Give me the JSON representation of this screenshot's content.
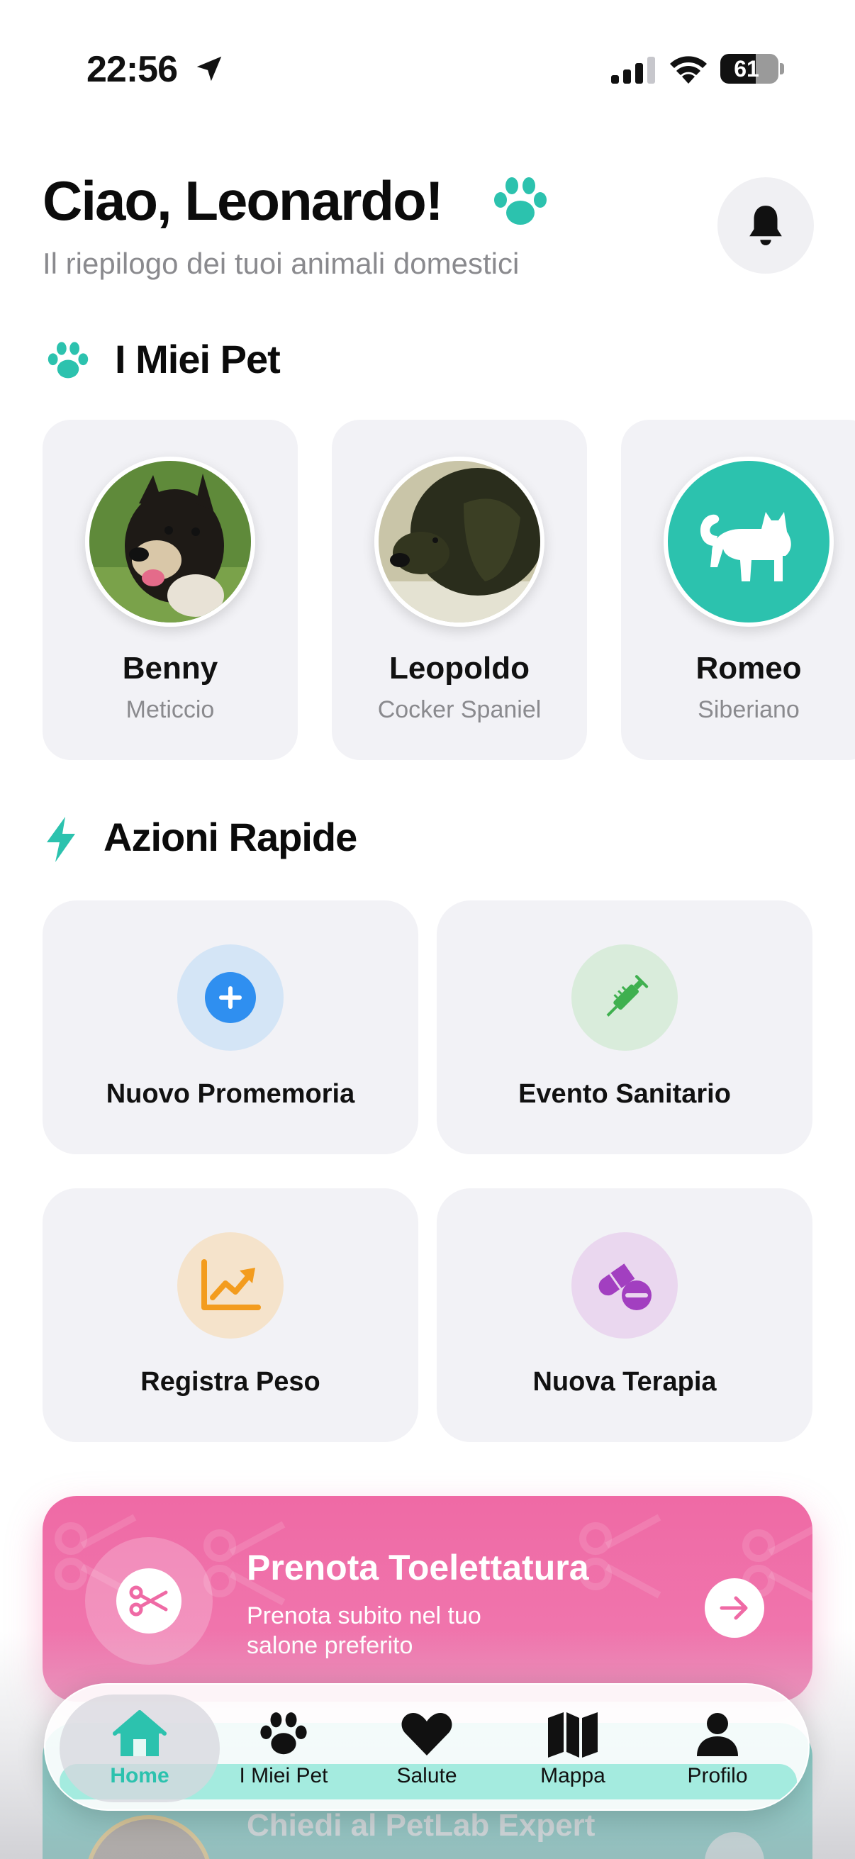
{
  "status_bar": {
    "time": "22:56",
    "battery": "61",
    "battery_level": 0.61
  },
  "header": {
    "greeting": "Ciao, Leonardo!",
    "subtitle": "Il riepilogo dei tuoi animali domestici"
  },
  "pets_section": {
    "title": "I Miei Pet",
    "pets": [
      {
        "name": "Benny",
        "breed": "Meticcio"
      },
      {
        "name": "Leopoldo",
        "breed": "Cocker Spaniel"
      },
      {
        "name": "Romeo",
        "breed": "Siberiano"
      }
    ]
  },
  "quick_actions": {
    "title": "Azioni Rapide",
    "items": [
      {
        "label": "Nuovo Promemoria",
        "icon": "plus-circle-icon",
        "color": "#2f8ff0"
      },
      {
        "label": "Evento Sanitario",
        "icon": "syringe-icon",
        "color": "#3fb04f"
      },
      {
        "label": "Registra Peso",
        "icon": "chart-up-icon",
        "color": "#f39c1e"
      },
      {
        "label": "Nuova Terapia",
        "icon": "pills-icon",
        "color": "#a23fc0"
      }
    ]
  },
  "promo": {
    "title": "Prenota Toelettatura",
    "text": "Prenota subito nel tuo salone preferito"
  },
  "expert": {
    "title": "Chiedi al PetLab Expert"
  },
  "tabbar": {
    "items": [
      {
        "label": "Home",
        "icon": "house-icon",
        "active": true
      },
      {
        "label": "I Miei Pet",
        "icon": "paw-icon",
        "active": false
      },
      {
        "label": "Salute",
        "icon": "heart-icon",
        "active": false
      },
      {
        "label": "Mappa",
        "icon": "map-icon",
        "active": false
      },
      {
        "label": "Profilo",
        "icon": "person-icon",
        "active": false
      }
    ]
  },
  "colors": {
    "accent": "#2cc2ae",
    "promo": "#ef6aa5",
    "card": "#f2f2f6"
  }
}
